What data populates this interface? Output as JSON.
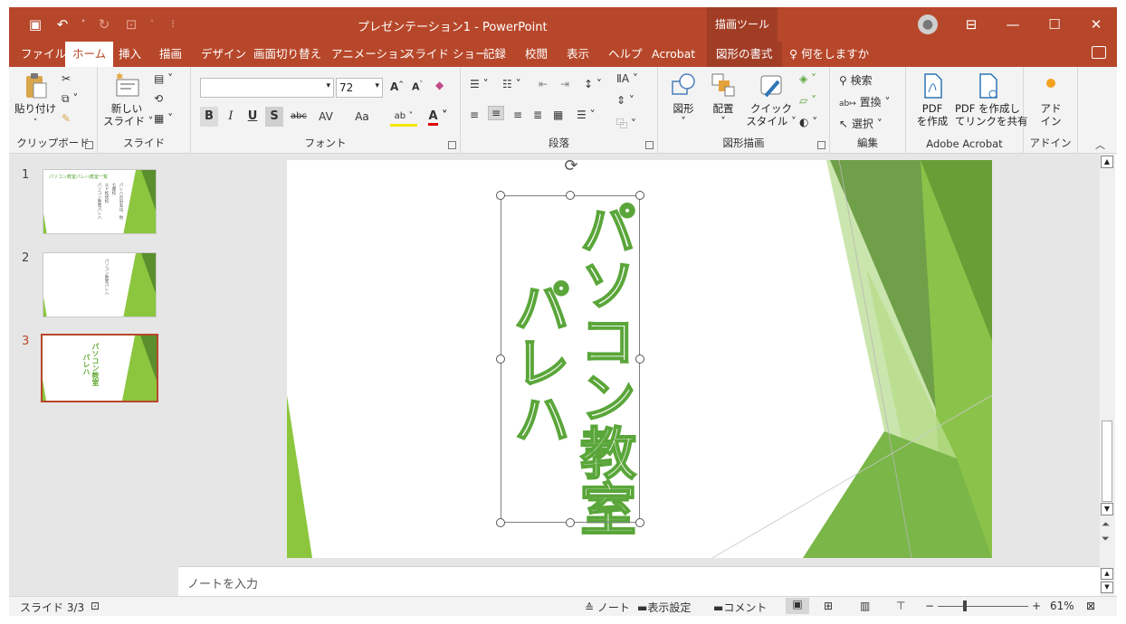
{
  "window": {
    "title": "プレゼンテーション1 - PowerPoint",
    "context_group": "描画ツール"
  },
  "tabs": [
    {
      "label": "ファイル",
      "state": "normal"
    },
    {
      "label": "ホーム",
      "state": "active"
    },
    {
      "label": "挿入",
      "state": "normal"
    },
    {
      "label": "描画",
      "state": "normal"
    },
    {
      "label": "デザイン",
      "state": "normal"
    },
    {
      "label": "画面切り替え",
      "state": "normal"
    },
    {
      "label": "アニメーション",
      "state": "normal"
    },
    {
      "label": "スライド ショー",
      "state": "normal"
    },
    {
      "label": "記録",
      "state": "normal"
    },
    {
      "label": "校閲",
      "state": "normal"
    },
    {
      "label": "表示",
      "state": "normal"
    },
    {
      "label": "ヘルプ",
      "state": "normal"
    },
    {
      "label": "Acrobat",
      "state": "normal"
    },
    {
      "label": "図形の書式",
      "state": "context"
    }
  ],
  "tell_me": "何をしますか",
  "ribbon": {
    "clipboard": {
      "label": "クリップボード",
      "paste": "貼り付け"
    },
    "slides": {
      "label": "スライド",
      "new_slide_1": "新しい",
      "new_slide_2": "スライド"
    },
    "font": {
      "label": "フォント",
      "font_name": "",
      "font_size": "72",
      "bold": "B",
      "italic": "I",
      "underline": "U",
      "shadow": "S",
      "strike": "abc",
      "spacing": "AV",
      "case": "Aa"
    },
    "paragraph": {
      "label": "段落"
    },
    "drawing": {
      "label": "図形描画",
      "shapes": "図形",
      "arrange": "配置",
      "quick_styles_1": "クイック",
      "quick_styles_2": "スタイル"
    },
    "editing": {
      "label": "編集",
      "find": "検索",
      "replace": "置換",
      "select": "選択"
    },
    "acrobat": {
      "label": "Adobe Acrobat",
      "create_pdf_1": "PDF",
      "create_pdf_2": "を作成",
      "share_1": "PDF を作成し",
      "share_2": "てリンクを共有"
    },
    "addins": {
      "label": "アドイン",
      "btn_1": "アド",
      "btn_2": "イン"
    }
  },
  "thumbnails": [
    {
      "num": "1",
      "title": "パソコン教室パレハ教室一覧",
      "lines": [
        "パソコン教室パレハ",
        "エド松伏校",
        "七郷校",
        "パレハの旧名は、他"
      ]
    },
    {
      "num": "2",
      "title": "",
      "lines": [
        "パソコン教室パレハ"
      ]
    },
    {
      "num": "3",
      "title": "",
      "lines": [
        "パソコン教室",
        "パレハ"
      ]
    }
  ],
  "slide": {
    "line1": "パソコン教室",
    "line2": "パレハ"
  },
  "notes_placeholder": "ノートを入力",
  "status": {
    "slide_counter": "スライド 3/3",
    "notes": "ノート",
    "display_settings": "表示設定",
    "comments": "コメント",
    "zoom": "61%"
  },
  "colors": {
    "brand": "#b7472a",
    "green_dark": "#5b8f2e",
    "green_light": "#8cc63f"
  }
}
